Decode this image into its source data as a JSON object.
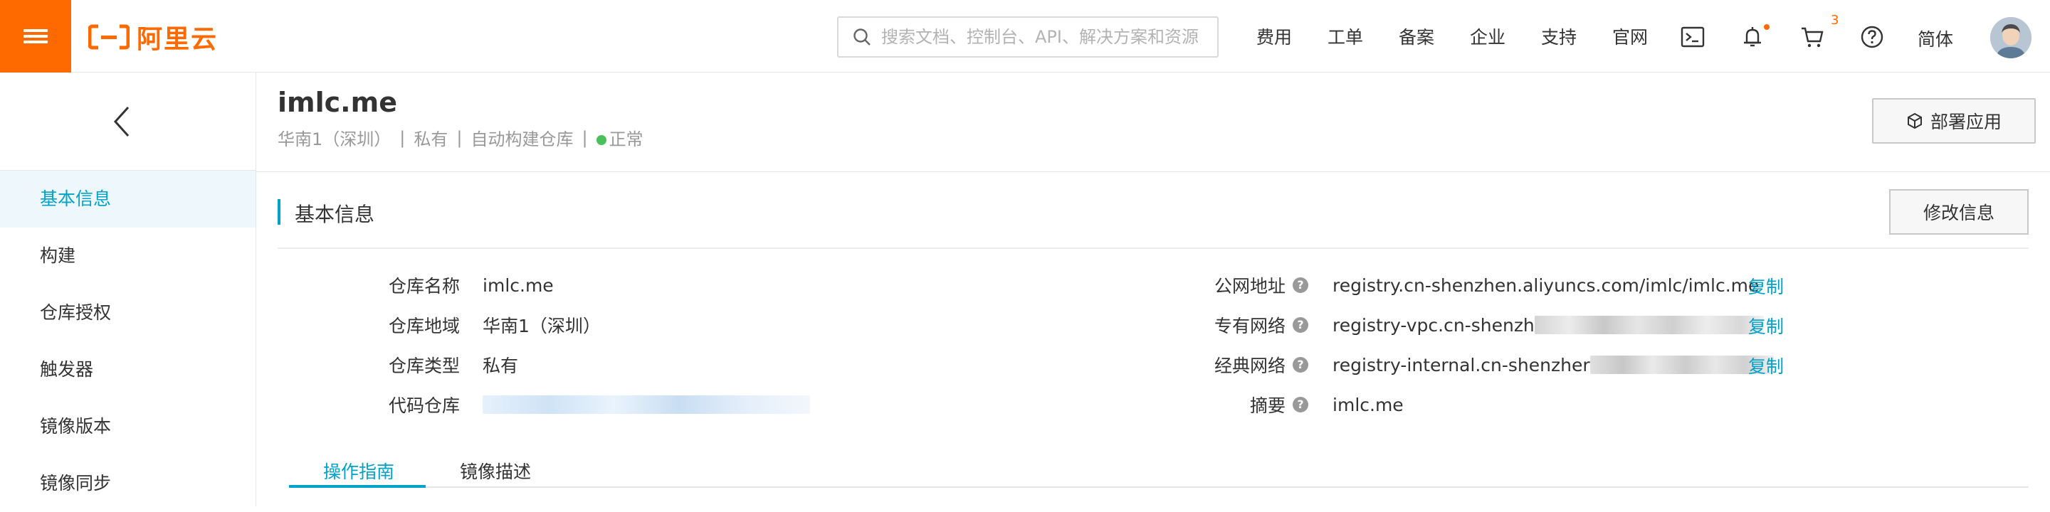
{
  "header": {
    "logo_text": "阿里云",
    "search_placeholder": "搜索文档、控制台、API、解决方案和资源",
    "nav": [
      "费用",
      "工单",
      "备案",
      "企业",
      "支持",
      "官网"
    ],
    "cart_count": "3",
    "lang": "简体",
    "accent": "#ff6a00"
  },
  "sidebar": {
    "items": [
      "基本信息",
      "构建",
      "仓库授权",
      "触发器",
      "镜像版本",
      "镜像同步"
    ],
    "active_index": 0
  },
  "repo": {
    "name": "imlc.me",
    "region": "华南1（深圳）",
    "type": "私有",
    "build": "自动构建仓库",
    "status": "正常",
    "deploy_label": "部署应用"
  },
  "basic_info": {
    "section_title": "基本信息",
    "edit_label": "修改信息",
    "left": [
      {
        "label": "仓库名称",
        "value": "imlc.me"
      },
      {
        "label": "仓库地域",
        "value": "华南1（深圳）"
      },
      {
        "label": "仓库类型",
        "value": "私有"
      },
      {
        "label": "代码仓库",
        "value": ""
      }
    ],
    "right": [
      {
        "label": "公网地址",
        "value": "registry.cn-shenzhen.aliyuncs.com/imlc/imlc.me",
        "copy": "复制"
      },
      {
        "label": "专有网络",
        "value": "registry-vpc.cn-shenzh",
        "copy": "复制"
      },
      {
        "label": "经典网络",
        "value": "registry-internal.cn-shenzher",
        "copy": "复制"
      },
      {
        "label": "摘要",
        "value": "imlc.me",
        "copy": ""
      }
    ]
  },
  "tabs": [
    "操作指南",
    "镜像描述"
  ],
  "active_tab": 0
}
